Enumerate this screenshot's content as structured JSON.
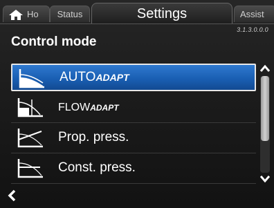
{
  "header": {
    "tabs": {
      "home": "Ho",
      "status": "Status",
      "settings": "Settings",
      "assist": "Assist"
    },
    "version": "3.1.3.0.0.0"
  },
  "page": {
    "title": "Control mode"
  },
  "control_modes": [
    {
      "main": "AUTO",
      "sub": "ADAPT",
      "selected": true,
      "icon": "autoadapt-curve-icon"
    },
    {
      "main": "FLOW",
      "sub": "ADAPT",
      "selected": false,
      "icon": "flowadapt-curve-icon"
    },
    {
      "main": "Prop. press.",
      "sub": "",
      "selected": false,
      "icon": "proportional-pressure-icon"
    },
    {
      "main": "Const. press.",
      "sub": "",
      "selected": false,
      "icon": "constant-pressure-icon"
    }
  ],
  "scrollbar": {
    "position_fraction": 0.0,
    "visible_fraction": 0.67
  },
  "colors": {
    "selection_blue": "#1a5fb3",
    "background": "#1a1a1a",
    "text": "#ffffff"
  },
  "icons": {
    "home": "home-icon",
    "back": "back-arrow-icon",
    "scroll_up": "chevron-up-icon",
    "scroll_down": "chevron-down-icon"
  }
}
